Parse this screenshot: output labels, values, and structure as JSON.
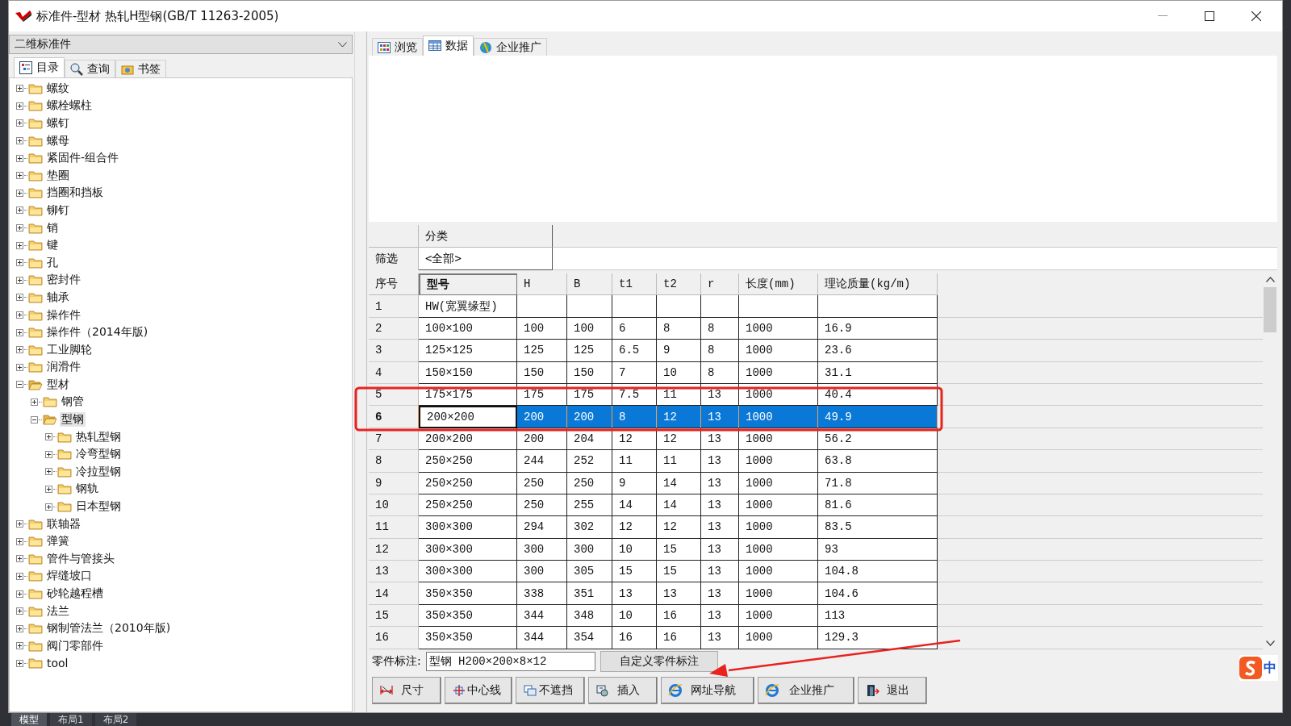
{
  "window": {
    "title": "标准件-型材 热轧H型钢(GB/T 11263-2005)"
  },
  "left_panel": {
    "category": "二维标准件",
    "tabs": [
      {
        "label": "目录",
        "selected": true,
        "kind": "catalog"
      },
      {
        "label": "查询",
        "selected": false,
        "kind": "search"
      },
      {
        "label": "书签",
        "selected": false,
        "kind": "bookmark"
      }
    ],
    "tree": [
      {
        "label": "螺纹",
        "expanded": false,
        "selected": false
      },
      {
        "label": "螺栓螺柱",
        "expanded": false,
        "selected": false
      },
      {
        "label": "螺钉",
        "expanded": false,
        "selected": false
      },
      {
        "label": "螺母",
        "expanded": false,
        "selected": false
      },
      {
        "label": "紧固件-组合件",
        "expanded": false,
        "selected": false
      },
      {
        "label": "垫圈",
        "expanded": false,
        "selected": false
      },
      {
        "label": "挡圈和挡板",
        "expanded": false,
        "selected": false
      },
      {
        "label": "铆钉",
        "expanded": false,
        "selected": false
      },
      {
        "label": "销",
        "expanded": false,
        "selected": false
      },
      {
        "label": "键",
        "expanded": false,
        "selected": false
      },
      {
        "label": "孔",
        "expanded": false,
        "selected": false
      },
      {
        "label": "密封件",
        "expanded": false,
        "selected": false
      },
      {
        "label": "轴承",
        "expanded": false,
        "selected": false
      },
      {
        "label": "操作件",
        "expanded": false,
        "selected": false
      },
      {
        "label": "操作件（2014年版)",
        "expanded": false,
        "selected": false
      },
      {
        "label": "工业脚轮",
        "expanded": false,
        "selected": false
      },
      {
        "label": "润滑件",
        "expanded": false,
        "selected": false
      },
      {
        "label": "型材",
        "expanded": true,
        "selected": false,
        "children": [
          {
            "label": "钢管",
            "expanded": false,
            "selected": false
          },
          {
            "label": "型钢",
            "expanded": true,
            "selected": true,
            "children": [
              {
                "label": "热轧型钢",
                "expanded": false,
                "selected": false
              },
              {
                "label": "冷弯型钢",
                "expanded": false,
                "selected": false
              },
              {
                "label": "冷拉型钢",
                "expanded": false,
                "selected": false
              },
              {
                "label": "钢轨",
                "expanded": false,
                "selected": false
              },
              {
                "label": "日本型钢",
                "expanded": false,
                "selected": false
              }
            ]
          }
        ]
      },
      {
        "label": "联轴器",
        "expanded": false,
        "selected": false
      },
      {
        "label": "弹簧",
        "expanded": false,
        "selected": false
      },
      {
        "label": "管件与管接头",
        "expanded": false,
        "selected": false
      },
      {
        "label": "焊缝坡口",
        "expanded": false,
        "selected": false
      },
      {
        "label": "砂轮越程槽",
        "expanded": false,
        "selected": false
      },
      {
        "label": "法兰",
        "expanded": false,
        "selected": false
      },
      {
        "label": "钢制管法兰（2010年版)",
        "expanded": false,
        "selected": false
      },
      {
        "label": "阀门零部件",
        "expanded": false,
        "selected": false
      },
      {
        "label": "tool",
        "expanded": false,
        "selected": false
      }
    ]
  },
  "right_panel": {
    "tabs": [
      {
        "label": "浏览",
        "selected": false,
        "kind": "grid"
      },
      {
        "label": "数据",
        "selected": true,
        "kind": "table"
      },
      {
        "label": "企业推广",
        "selected": false,
        "kind": "globe"
      }
    ],
    "filter": {
      "column": "分类",
      "row_label": "筛选",
      "value": "<全部>"
    },
    "table": {
      "columns": [
        {
          "label": "序号",
          "selected": false
        },
        {
          "label": "型号",
          "selected": true
        },
        {
          "label": "H",
          "selected": false
        },
        {
          "label": "B",
          "selected": false
        },
        {
          "label": "t1",
          "selected": false
        },
        {
          "label": "t2",
          "selected": false
        },
        {
          "label": "r",
          "selected": false
        },
        {
          "label": "长度(mm)",
          "selected": false
        },
        {
          "label": "理论质量(kg/m)",
          "selected": false
        }
      ],
      "rows": [
        {
          "selected": false,
          "cells": [
            "1",
            "HW(宽翼缘型)",
            "",
            "",
            "",
            "",
            "",
            "",
            ""
          ]
        },
        {
          "selected": false,
          "cells": [
            "2",
            "100×100",
            "100",
            "100",
            "6",
            "8",
            "8",
            "1000",
            "16.9"
          ]
        },
        {
          "selected": false,
          "cells": [
            "3",
            "125×125",
            "125",
            "125",
            "6.5",
            "9",
            "8",
            "1000",
            "23.6"
          ]
        },
        {
          "selected": false,
          "cells": [
            "4",
            "150×150",
            "150",
            "150",
            "7",
            "10",
            "8",
            "1000",
            "31.1"
          ]
        },
        {
          "selected": false,
          "cells": [
            "5",
            "175×175",
            "175",
            "175",
            "7.5",
            "11",
            "13",
            "1000",
            "40.4"
          ]
        },
        {
          "selected": true,
          "cells": [
            "6",
            "200×200",
            "200",
            "200",
            "8",
            "12",
            "13",
            "1000",
            "49.9"
          ]
        },
        {
          "selected": false,
          "cells": [
            "7",
            "200×200",
            "200",
            "204",
            "12",
            "12",
            "13",
            "1000",
            "56.2"
          ]
        },
        {
          "selected": false,
          "cells": [
            "8",
            "250×250",
            "244",
            "252",
            "11",
            "11",
            "13",
            "1000",
            "63.8"
          ]
        },
        {
          "selected": false,
          "cells": [
            "9",
            "250×250",
            "250",
            "250",
            "9",
            "14",
            "13",
            "1000",
            "71.8"
          ]
        },
        {
          "selected": false,
          "cells": [
            "10",
            "250×250",
            "250",
            "255",
            "14",
            "14",
            "13",
            "1000",
            "81.6"
          ]
        },
        {
          "selected": false,
          "cells": [
            "11",
            "300×300",
            "294",
            "302",
            "12",
            "12",
            "13",
            "1000",
            "83.5"
          ]
        },
        {
          "selected": false,
          "cells": [
            "12",
            "300×300",
            "300",
            "300",
            "10",
            "15",
            "13",
            "1000",
            "93"
          ]
        },
        {
          "selected": false,
          "cells": [
            "13",
            "300×300",
            "300",
            "305",
            "15",
            "15",
            "13",
            "1000",
            "104.8"
          ]
        },
        {
          "selected": false,
          "cells": [
            "14",
            "350×350",
            "338",
            "351",
            "13",
            "13",
            "13",
            "1000",
            "104.6"
          ]
        },
        {
          "selected": false,
          "cells": [
            "15",
            "350×350",
            "344",
            "348",
            "10",
            "16",
            "13",
            "1000",
            "113"
          ]
        },
        {
          "selected": false,
          "cells": [
            "16",
            "350×350",
            "344",
            "354",
            "16",
            "16",
            "13",
            "1000",
            "129.3"
          ]
        }
      ]
    },
    "part_label": {
      "label": "零件标注:",
      "value": "型钢 H200×200×8×12",
      "button": "自定义零件标注"
    },
    "buttons": [
      {
        "label": "尺寸",
        "kind": "dimension"
      },
      {
        "label": "中心线",
        "kind": "centerline"
      },
      {
        "label": "不遮挡",
        "kind": "overlap"
      },
      {
        "label": "插入",
        "kind": "insert"
      },
      {
        "label": "网址导航",
        "kind": "browser"
      },
      {
        "label": "企业推广",
        "kind": "browser"
      },
      {
        "label": "退出",
        "kind": "exit"
      }
    ]
  },
  "ime": {
    "label": "中"
  },
  "background_tabs": [
    {
      "label": "模型",
      "selected": true
    },
    {
      "label": "布局1",
      "selected": false
    },
    {
      "label": "布局2",
      "selected": false
    }
  ]
}
